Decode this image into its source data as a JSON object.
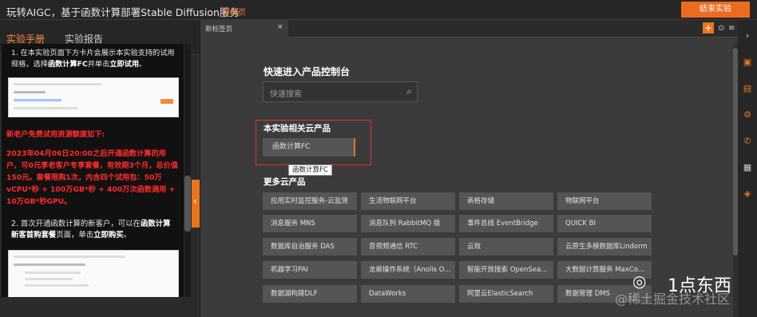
{
  "header": {
    "title": "玩转AIGC，基于函数计算部署Stable Diffusion服务",
    "detail_link": "详情页",
    "end_button": "结束实验"
  },
  "left_tabs": [
    "实验手册",
    "实验报告"
  ],
  "manual": {
    "step1_text": "1. 在本实验页面下方卡片会展示本实验支持的试用规格，选择",
    "step1_bold": "函数计算FC",
    "step1_tail": "并单击",
    "step1_action": "立即试用",
    "free_heading": "新老户免费试用资源额度如下:",
    "free_detail": "2023年04月06日20:00之后开通函数计算的用户，可0元享老客户专享套餐，有效期3个月，总价值150元。套餐限购1次，内含四个试用包：50万vCPU*秒 + 100万GB*秒 + 400万次函数调用 + 10万GB*秒GPU。",
    "step2_text": "2. 首次开通函数计算的新客户，可以在",
    "step2_bold": "函数计算新客首购套餐",
    "step2_tail": "页面，单击",
    "step2_action": "立即购买"
  },
  "browser_tab": {
    "label": "新标签页",
    "close": "×"
  },
  "console": {
    "quick_title": "快速进入产品控制台",
    "search_placeholder": "快速搜索",
    "related_title": "本实验相关云产品",
    "fc_button": "函数计算FC",
    "tooltip": "函数计算FC",
    "more_title": "更多云产品",
    "products": [
      [
        "应用实时监控服务-云监测",
        "生活物联网平台",
        "表格存储",
        "物联网平台"
      ],
      [
        "消息服务 MNS",
        "消息队列 RabbitMQ 版",
        "事件总线 EventBridge",
        "QUICK BI"
      ],
      [
        "数据库自治服务 DAS",
        "音视频通信 RTC",
        "云效",
        "云原生多模数据库Lindorm"
      ],
      [
        "机器学习PAI",
        "龙蜥操作系统（Anolis O…",
        "智能开放搜索 OpenSea…",
        "大数据计算服务 MaxCo…"
      ],
      [
        "数据湖构建DLF",
        "DataWorks",
        "阿里云ElasticSearch",
        "数据管理 DMS"
      ]
    ]
  },
  "watermark": {
    "brand": "1点东西",
    "site": "@稀土掘金技术社区"
  },
  "colors": {
    "accent": "#ee6a1f",
    "warning_red": "#ff2b2b"
  }
}
